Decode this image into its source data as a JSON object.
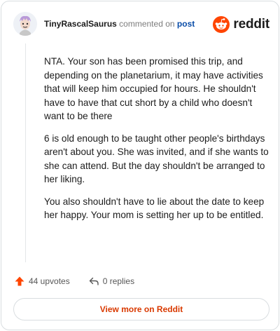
{
  "header": {
    "username": "TinyRascalSaurus",
    "action_text": "commented on",
    "post_link": "post"
  },
  "logo": {
    "wordmark": "reddit",
    "brand_color": "#ff4500"
  },
  "comment": {
    "paragraphs": [
      "NTA. Your son has been promised this trip, and depending on the planetarium, it may have activities that will keep him occupied for hours. He shouldn't have to have that cut short by a child who doesn't want to be there",
      "6 is old enough to be taught other people's birthdays aren't about you. She was invited, and if she wants to she can attend. But the day shouldn't be arranged to her liking.",
      "You also shouldn't have to lie about the date to keep her happy. Your mom is setting her up to be entitled."
    ]
  },
  "actions": {
    "upvotes_label": "44 upvotes",
    "replies_label": "0 replies",
    "upvote_icon": "arrow-up-icon",
    "reply_icon": "reply-icon"
  },
  "footer": {
    "view_more_label": "View more on Reddit",
    "accent_color": "#d93900"
  }
}
